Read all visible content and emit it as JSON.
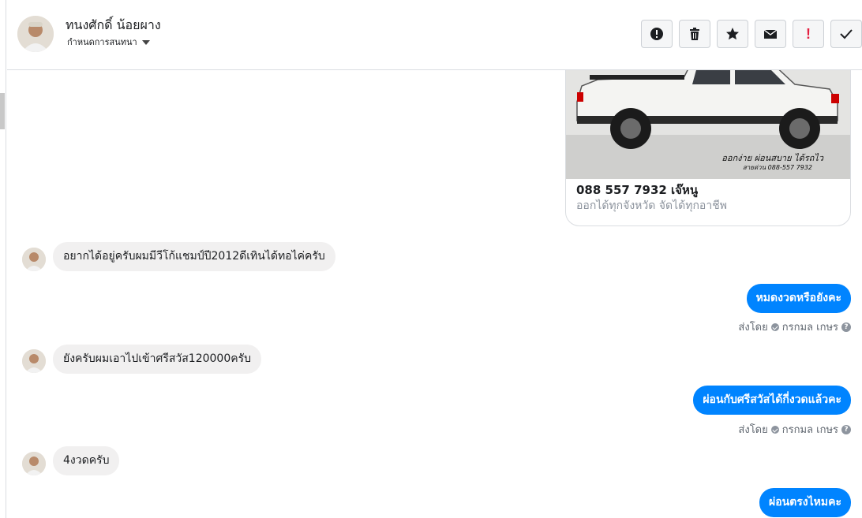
{
  "header": {
    "contact_name": "ทนงศักดิ์ น้อยผาง",
    "label_selector": "กำหนดการสนทนา",
    "actions": [
      {
        "name": "info-action-button",
        "icon": "alert-circle-icon"
      },
      {
        "name": "delete-action-button",
        "icon": "trash-icon"
      },
      {
        "name": "star-action-button",
        "icon": "star-icon"
      },
      {
        "name": "mark-unread-button",
        "icon": "envelope-icon"
      },
      {
        "name": "spam-button",
        "icon": "exclamation-icon",
        "glyph": "!"
      },
      {
        "name": "done-button",
        "icon": "check-icon"
      }
    ]
  },
  "card": {
    "image_caption_line1": "ออกง่าย ผ่อนสบาย ได้รถไว",
    "image_caption_line2": "สายด่วน 088-557 7932",
    "title": "088 557 7932 เจ๊หนู",
    "subtitle": "ออกได้ทุกจังหวัด จัดได้ทุกอาชีพ"
  },
  "messages": [
    {
      "direction": "in",
      "text": "อยากได้อยู่ครับผมมีวีโก้แชมป์ปี2012ดีเทินได้ทอไค่ครับ"
    },
    {
      "direction": "out",
      "text": "หมดงวดหรือยังคะ",
      "sent_by_label": "ส่งโดย",
      "sender": "กรกมล เกษร"
    },
    {
      "direction": "in",
      "text": "ยังครับผมเอาไปเข้าศรีสวัส120000ครับ"
    },
    {
      "direction": "out",
      "text": "ผ่อนกับศรีสวัสได้กี่งวดแล้วคะ",
      "sent_by_label": "ส่งโดย",
      "sender": "กรกมล เกษร"
    },
    {
      "direction": "in",
      "text": "4งวดครับ"
    },
    {
      "direction": "out",
      "text": "ผ่อนตรงไหมคะ"
    }
  ],
  "colors": {
    "outgoing_bubble": "#0084ff",
    "incoming_bubble": "#f1f0f0",
    "spam_red": "#e41e3f"
  }
}
